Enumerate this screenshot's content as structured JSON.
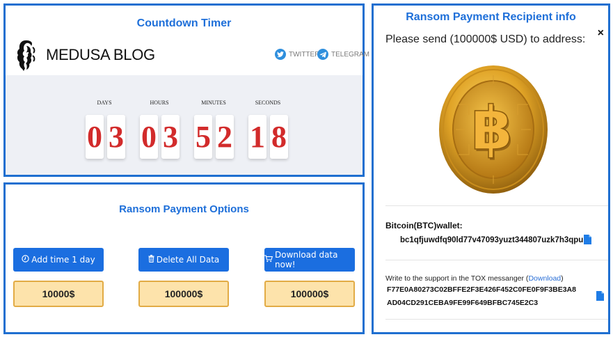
{
  "timer": {
    "title": "Countdown Timer",
    "blog_name": "MEDUSA BLOG",
    "social": {
      "twitter": "TWITTER",
      "telegram": "TELEGRAM"
    },
    "units": [
      {
        "label": "DAYS",
        "digits": [
          "0",
          "3"
        ]
      },
      {
        "label": "HOURS",
        "digits": [
          "0",
          "3"
        ]
      },
      {
        "label": "MINUTES",
        "digits": [
          "5",
          "2"
        ]
      },
      {
        "label": "SECONDS",
        "digits": [
          "1",
          "8"
        ]
      }
    ]
  },
  "options": {
    "title": "Ransom Payment Options",
    "items": [
      {
        "label": "Add time 1 day",
        "icon": "clock-icon",
        "price": "10000$"
      },
      {
        "label": "Delete All Data",
        "icon": "trash-icon",
        "price": "100000$"
      },
      {
        "label": "Download data now!",
        "icon": "cart-icon",
        "price": "100000$"
      }
    ]
  },
  "recipient": {
    "title": "Ransom Payment Recipient info",
    "close_label": "×",
    "send_text": "Please send (100000$ USD) to address:",
    "wallet_label": "Bitcoin(BTC)wallet:",
    "wallet_address": "bc1qfjuwdfq90ld77v47093yuzt344807uzk7h3qpu",
    "tox_prefix": "Write to the support in the TOX messanger (",
    "tox_link": "Download",
    "tox_suffix": ")",
    "tox_id_line1": "F77E0A80273C02BFFE2F3E426F452C0FE0F9F3BE3A8",
    "tox_id_line2": "AD04CD291CEBA9FE99F649BFBC745E2C3"
  },
  "colors": {
    "accent": "#1e6fd9",
    "digit": "#d22b2b",
    "price_bg": "#fde3ab"
  }
}
